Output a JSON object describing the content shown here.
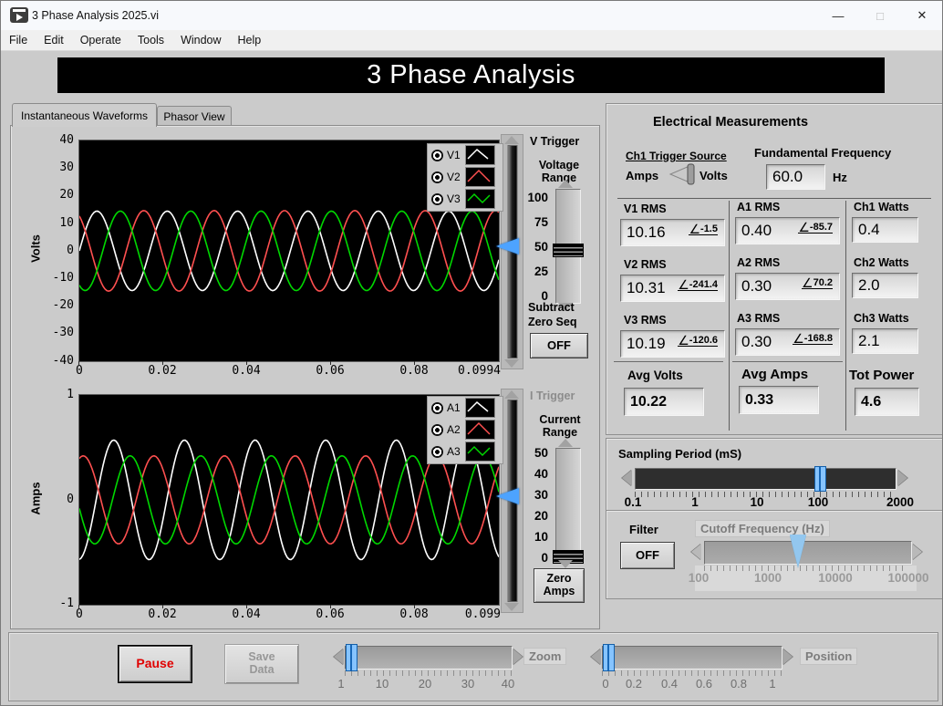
{
  "window": {
    "title": "3 Phase Analysis 2025.vi",
    "controls": {
      "minimize": "—",
      "maximize": "□",
      "close": "✕"
    }
  },
  "menu": {
    "items": [
      "File",
      "Edit",
      "Operate",
      "Tools",
      "Window",
      "Help"
    ]
  },
  "banner": {
    "title": "3 Phase Analysis"
  },
  "tabs": {
    "tab1": "Instantaneous Waveforms",
    "tab2": "Phasor View"
  },
  "chart_data": [
    {
      "type": "line",
      "name": "instantaneous-voltage-chart",
      "ylabel": "Volts",
      "ylim": [
        -40,
        40
      ],
      "xlim": [
        0,
        0.0994
      ],
      "frequency_hz": 60,
      "grid": false,
      "background": "#000000",
      "legend_position": "top-right",
      "y_ticks": [
        "40",
        "30",
        "20",
        "10",
        "0",
        "-10",
        "-20",
        "-30",
        "-40"
      ],
      "x_ticks": [
        "0",
        "0.02",
        "0.04",
        "0.06",
        "0.08",
        "0.0994"
      ],
      "series": [
        {
          "name": "V1",
          "color": "#ffffff",
          "amplitude": 14.4,
          "phase_deg": 0
        },
        {
          "name": "V2",
          "color": "#ff5050",
          "amplitude": 14.6,
          "phase_deg": 120
        },
        {
          "name": "V3",
          "color": "#00d800",
          "amplitude": 14.4,
          "phase_deg": -120
        }
      ]
    },
    {
      "type": "line",
      "name": "instantaneous-current-chart",
      "ylabel": "Amps",
      "ylim": [
        -1,
        1
      ],
      "xlim": [
        0,
        0.099
      ],
      "frequency_hz": 60,
      "grid": false,
      "background": "#000000",
      "legend_position": "top-right",
      "y_ticks": [
        "1",
        "0",
        "-1"
      ],
      "x_ticks": [
        "0",
        "0.02",
        "0.04",
        "0.06",
        "0.08",
        "0.099"
      ],
      "series": [
        {
          "name": "A1",
          "color": "#ffffff",
          "amplitude": 0.57,
          "phase_deg": -85.7
        },
        {
          "name": "A2",
          "color": "#ff5050",
          "amplitude": 0.42,
          "phase_deg": 70.2
        },
        {
          "name": "A3",
          "color": "#00d800",
          "amplitude": 0.42,
          "phase_deg": -168.8
        }
      ]
    }
  ],
  "v_trigger": {
    "title": "V Trigger",
    "range_label": "Voltage Range",
    "scale": [
      "100",
      "75",
      "50",
      "25",
      "0"
    ],
    "value": 42,
    "subtract_label": "Subtract Zero Seq",
    "subtract_button": "OFF",
    "trigger_level": 0
  },
  "i_trigger": {
    "title": "I Trigger",
    "range_label": "Current Range",
    "scale": [
      "50",
      "40",
      "30",
      "20",
      "10",
      "0"
    ],
    "value": 0,
    "zero_button": "Zero Amps",
    "trigger_level": 0
  },
  "measurements": {
    "title": "Electrical Measurements",
    "angle_symbol": "∠",
    "trigger_source": {
      "label": "Ch1 Trigger Source",
      "left": "Amps",
      "right": "Volts",
      "selected": "Volts"
    },
    "fundamental": {
      "label": "Fundamental Frequency",
      "value": "60.0",
      "unit": "Hz"
    },
    "volts": [
      {
        "label": "V1 RMS",
        "value": "10.16",
        "angle": "-1.5"
      },
      {
        "label": "V2 RMS",
        "value": "10.31",
        "angle": "-241.4"
      },
      {
        "label": "V3 RMS",
        "value": "10.19",
        "angle": "-120.6"
      }
    ],
    "amps": [
      {
        "label": "A1 RMS",
        "value": "0.40",
        "angle": "-85.7"
      },
      {
        "label": "A2 RMS",
        "value": "0.30",
        "angle": "70.2"
      },
      {
        "label": "A3 RMS",
        "value": "0.30",
        "angle": "-168.8"
      }
    ],
    "watts": [
      {
        "label": "Ch1 Watts",
        "value": "0.4"
      },
      {
        "label": "Ch2 Watts",
        "value": "2.0"
      },
      {
        "label": "Ch3 Watts",
        "value": "2.1"
      }
    ],
    "avg_volts": {
      "label": "Avg Volts",
      "value": "10.22"
    },
    "avg_amps": {
      "label": "Avg Amps",
      "value": "0.33"
    },
    "tot_power": {
      "label": "Tot Power",
      "value": "4.6"
    }
  },
  "sampling": {
    "label": "Sampling Period (mS)",
    "scale": [
      "0.1",
      "1",
      "10",
      "100",
      "2000"
    ],
    "value": 100
  },
  "filter": {
    "label": "Filter",
    "button": "OFF",
    "cutoff_label": "Cutoff Frequency (Hz)",
    "cutoff_scale": [
      "100",
      "1000",
      "10000",
      "100000"
    ],
    "cutoff_value": 3000
  },
  "footer": {
    "pause": "Pause",
    "save": "Save Data",
    "zoom_label": "Zoom",
    "zoom_scale": [
      "1",
      "10",
      "20",
      "30",
      "40"
    ],
    "zoom_value": 1,
    "position_label": "Position",
    "position_scale": [
      "0",
      "0.2",
      "0.4",
      "0.6",
      "0.8",
      "1"
    ],
    "position_value": 0
  }
}
